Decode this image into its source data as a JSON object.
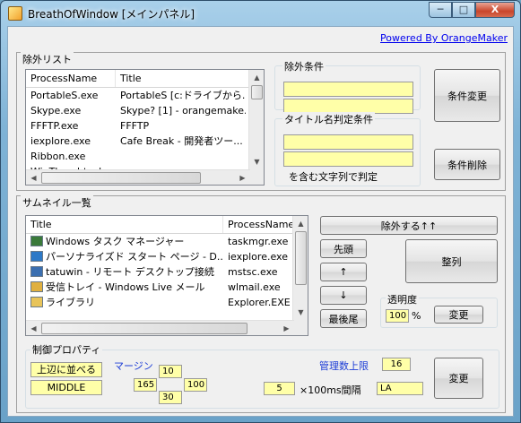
{
  "window": {
    "title": "BreathOfWindow [メインパネル]",
    "minimize": "─",
    "maximize": "□",
    "close": "X",
    "powered_link": "Powered By OrangeMaker"
  },
  "exclude_list": {
    "label": "除外リスト",
    "columns": [
      "ProcessName",
      "Title"
    ],
    "rows": [
      [
        "PortableS.exe",
        "PortableS [c:ドライブから..."
      ],
      [
        "Skype.exe",
        "Skype? [1] - orangemake..."
      ],
      [
        "FFFTP.exe",
        "FFFTP"
      ],
      [
        "iexplore.exe",
        "Cafe Break - 開発者ツー..."
      ],
      [
        "Ribbon.exe",
        ""
      ],
      [
        "WinThumbtack.e...",
        ""
      ]
    ]
  },
  "exclude_condition": {
    "label": "除外条件",
    "field1": "",
    "field2": ""
  },
  "title_condition": {
    "label": "タイトル名判定条件",
    "field1": "",
    "field2": "",
    "note": "を含む文字列で判定"
  },
  "buttons": {
    "change_condition": "条件変更",
    "delete_condition": "条件削除",
    "exclude_up": "除外する↑↑",
    "first": "先頭",
    "up": "↑",
    "down": "↓",
    "last": "最後尾",
    "arrange": "整列",
    "change_opacity": "変更",
    "change_props": "変更"
  },
  "thumbnail_list": {
    "label": "サムネイル一覧",
    "columns": [
      "Title",
      "ProcessName"
    ],
    "rows": [
      {
        "title": "Windows タスク マネージャー",
        "process": "taskmgr.exe",
        "icon": "taskmgr-icon",
        "color": "#3a7a3a"
      },
      {
        "title": "パーソナライズド スタート ページ - D...",
        "process": "iexplore.exe",
        "icon": "ie-icon",
        "color": "#2d79c7"
      },
      {
        "title": "tatuwin - リモート デスクトップ接続",
        "process": "mstsc.exe",
        "icon": "rdp-icon",
        "color": "#3b6fb0"
      },
      {
        "title": "受信トレイ - Windows Live メール",
        "process": "wlmail.exe",
        "icon": "mail-icon",
        "color": "#e0b040"
      },
      {
        "title": "ライブラリ",
        "process": "Explorer.EXE",
        "icon": "folder-icon",
        "color": "#e8c45a"
      }
    ]
  },
  "opacity": {
    "label": "透明度",
    "value": "100",
    "unit": "%"
  },
  "control_props": {
    "label": "制御プロパティ",
    "align_top": "上辺に並べる",
    "middle": "MIDDLE",
    "margin_label": "マージン",
    "margin_top": "10",
    "margin_left": "165",
    "margin_right": "100",
    "margin_bottom": "30",
    "max_label": "管理数上限",
    "max_value": "16",
    "interval_value": "5",
    "interval_unit": "×100ms間隔",
    "la_value": "LA"
  }
}
